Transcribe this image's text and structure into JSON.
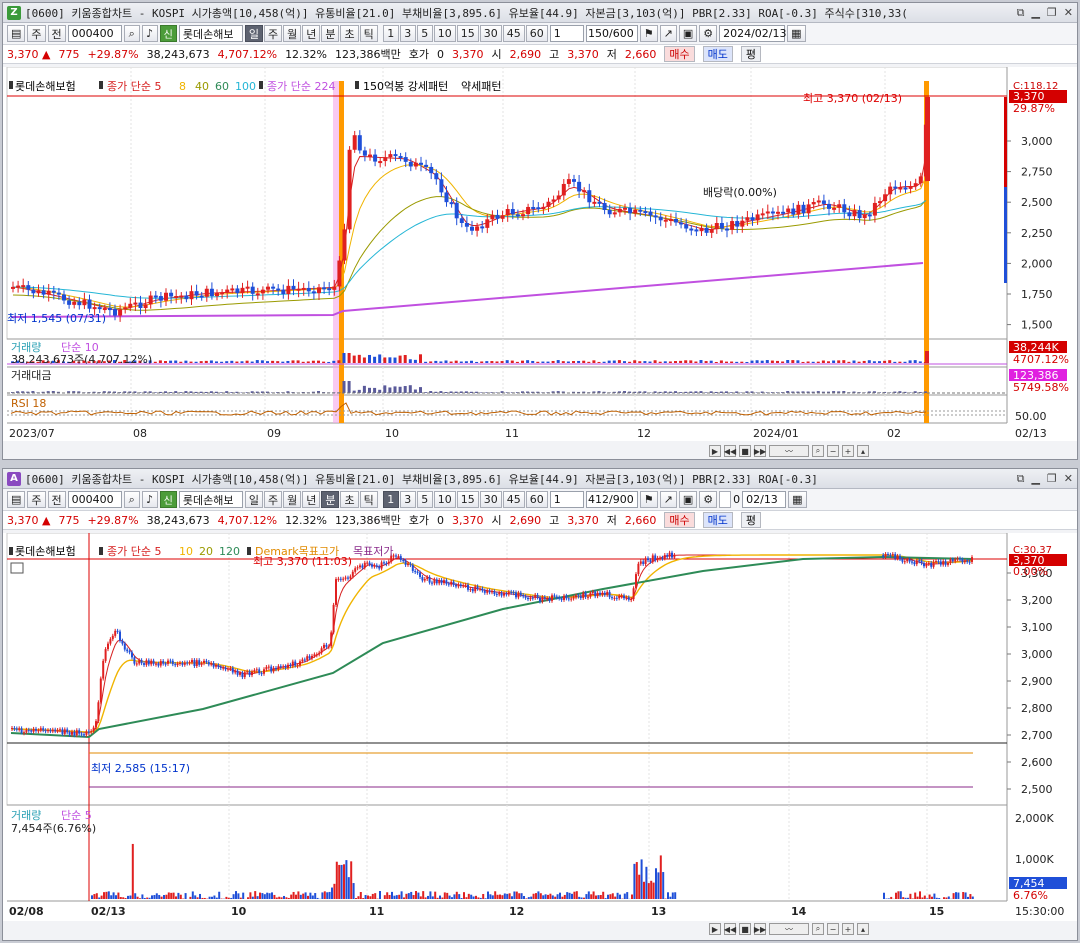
{
  "top": {
    "badge": "Z",
    "title": "[0600] 키움종합차트 - KOSPI 시가총액[10,458(억)] 유통비율[21.0] 부채비율[3,895.6] 유보율[44.9] 자본금[3,103(억)] PBR[2.33] ROA[-0.3] 주식수[310,33(",
    "toolbar": {
      "stock_code": "000400",
      "stock_name": "롯데손해보",
      "mode": "주",
      "scope": "전",
      "periods": [
        "일",
        "주",
        "월",
        "년",
        "분",
        "초",
        "틱"
      ],
      "selected_period": "일",
      "intervals": [
        "1",
        "3",
        "5",
        "10",
        "15",
        "30",
        "45",
        "60"
      ],
      "interval_value": "1",
      "count": "150/600",
      "date": "2024/02/13"
    },
    "quote": {
      "price": "3,370",
      "arrow": "▲",
      "change": "775",
      "rate": "+29.87%",
      "volume": "38,243,673",
      "vol_rate": "4,707.12%",
      "turnover": "12.32%",
      "amount": "123,386백만",
      "hoga_label": "호가",
      "hoga": "0",
      "cur": "3,370",
      "open_label": "시",
      "open": "2,690",
      "high_label": "고",
      "high": "3,370",
      "low_label": "저",
      "low": "2,660",
      "buy": "매수",
      "sell": "매도",
      "flat": "평"
    },
    "legend": {
      "name": "롯데손해보험",
      "ma_label": "종가 단순 5",
      "ma_periods": [
        "8",
        "40",
        "60",
        "100"
      ],
      "ma2": "종가 단순 224",
      "pattern": "150억봉 강세패턴",
      "pattern2": "약세패턴"
    },
    "annotations": {
      "high": "최고 3,370 (02/13)",
      "low": "최저 1,545 (07/31)",
      "dividend": "배당락(0.00%)",
      "top_right": "C:118.12",
      "pct": "29.87%"
    },
    "price_ticks": [
      "3,000",
      "2,750",
      "2,500",
      "2,250",
      "2,000",
      "1,750",
      "1,500"
    ],
    "last_price": "3,370",
    "volume_panel": {
      "label": "거래량",
      "ma": "단순 10",
      "value": "38,243,673주(4,707.12%)",
      "tag": "38,244K",
      "tag2": "4707.12%"
    },
    "amount_panel": {
      "label": "거래대금",
      "tag": "123,386",
      "tag2": "5749.58%"
    },
    "rsi_panel": {
      "label": "RSI 18",
      "tick": "50.00"
    },
    "x_ticks": [
      "2023/07",
      "08",
      "09",
      "10",
      "11",
      "12",
      "2024/01",
      "02"
    ],
    "x_end": "02/13"
  },
  "bottom": {
    "badge": "A",
    "title": "[0600] 키움종합차트 - KOSPI 시가총액[10,458(억)] 유통비율[21.0] 부채비율[3,895.6] 유보율[44.9] 자본금[3,103(억)] PBR[2.33] ROA[-0.3]",
    "toolbar": {
      "stock_code": "000400",
      "stock_name": "롯데손해보",
      "mode": "주",
      "scope": "전",
      "periods": [
        "일",
        "주",
        "월",
        "년",
        "분",
        "초",
        "틱"
      ],
      "selected_period": "분",
      "intervals": [
        "1",
        "3",
        "5",
        "10",
        "15",
        "30",
        "45",
        "60"
      ],
      "interval_value": "1",
      "count": "412/900",
      "check": "0",
      "date": "02/13"
    },
    "quote": {
      "price": "3,370",
      "arrow": "▲",
      "change": "775",
      "rate": "+29.87%",
      "volume": "38,243,673",
      "vol_rate": "4,707.12%",
      "turnover": "12.32%",
      "amount": "123,386백만",
      "hoga_label": "호가",
      "hoga": "0",
      "cur": "3,370",
      "open_label": "시",
      "open": "2,690",
      "high_label": "고",
      "high": "3,370",
      "low_label": "저",
      "low": "2,660",
      "buy": "매수",
      "sell": "매도",
      "flat": "평"
    },
    "legend": {
      "name": "롯데손해보험",
      "ma_label": "종가 단순 5",
      "ma_periods": [
        "10",
        "20",
        "120"
      ],
      "demark": "Demark목표고가",
      "demark2": "목표저가"
    },
    "annotations": {
      "high": "최고 3,370 (11:03)",
      "low": "최저 2,585 (15:17)",
      "top_right": "C:30.37",
      "pct": "0.00%"
    },
    "price_ticks": [
      "3,300",
      "3,200",
      "3,100",
      "3,000",
      "2,900",
      "2,800",
      "2,700",
      "2,600",
      "2,500"
    ],
    "last_price": "3,370",
    "volume_panel": {
      "label": "거래량",
      "ma": "단순 5",
      "value": "7,454주(6.76%)",
      "tick1": "2,000K",
      "tick2": "1,000K",
      "tag": "7,454",
      "tag2": "6.76%"
    },
    "x_ticks": [
      "02/08",
      "02/13",
      "10",
      "11",
      "12",
      "13",
      "14",
      "15"
    ],
    "x_end": "15:30:00"
  },
  "colors": {
    "up": "#e02020",
    "down": "#1f4fd8",
    "ma5": "#d62020",
    "ma_yellow": "#f0b400",
    "ma_green": "#2e8b57",
    "ma_cyan": "#25b6d6",
    "ma_purple": "#c050e0",
    "orange": "#ff9a00"
  },
  "icons": [
    "minimize-icon",
    "restore-icon",
    "close-icon",
    "settings-icon",
    "calendar-icon",
    "scroll-left-icon",
    "scroll-right-icon",
    "zoom-in-icon",
    "zoom-out-icon"
  ]
}
